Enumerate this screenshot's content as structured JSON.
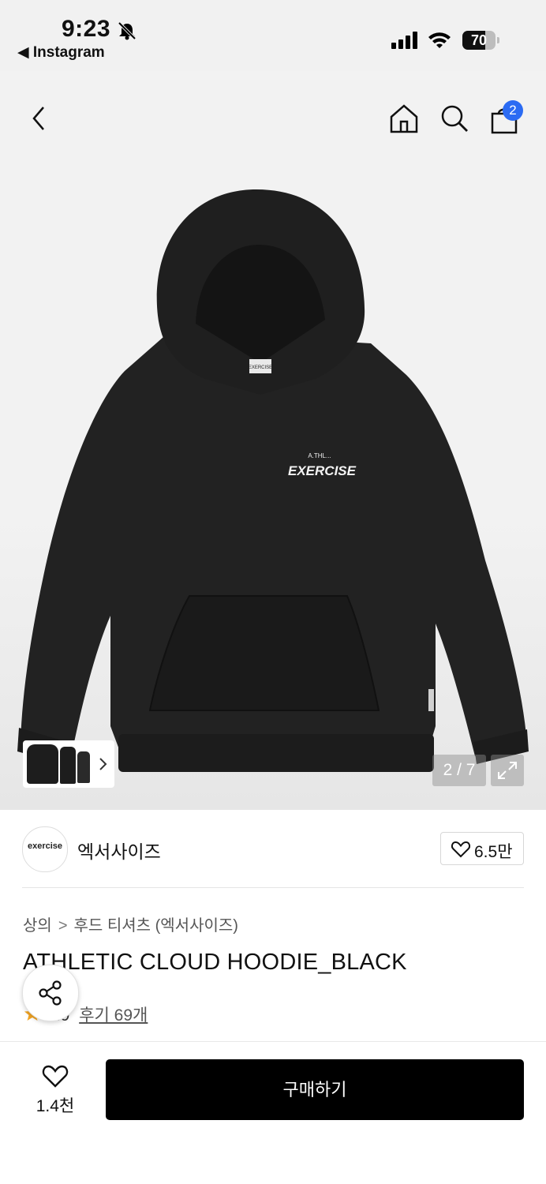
{
  "status_bar": {
    "time": "9:23",
    "back_app": "◀ Instagram",
    "battery": "70",
    "battery_level": 0.7
  },
  "header": {
    "back_icon": "chevron-left-icon",
    "home_icon": "home-icon",
    "search_icon": "search-icon",
    "cart_icon": "shopping-bag-icon",
    "cart_count": "2"
  },
  "gallery": {
    "pager": "2 / 7",
    "product_logo_small": "A.THL...",
    "product_logo": "EXERCISE",
    "label_tag": "EXERCISE"
  },
  "brand": {
    "logo_text": "exercise",
    "name": "엑서사이즈",
    "likes": "6.5만"
  },
  "product": {
    "breadcrumb": [
      "상의",
      "후드 티셔츠 (엑서사이즈)"
    ],
    "breadcrumb_sep": ">",
    "title": "ATHLETIC CLOUD HOODIE_BLACK",
    "rating": ".9",
    "reviews": "후기 69개"
  },
  "bottom_bar": {
    "wish_count": "1.4천",
    "buy_label": "구매하기"
  },
  "colors": {
    "accent": "#2b6bf3",
    "star": "#f5a623",
    "buy_button": "#000000"
  }
}
